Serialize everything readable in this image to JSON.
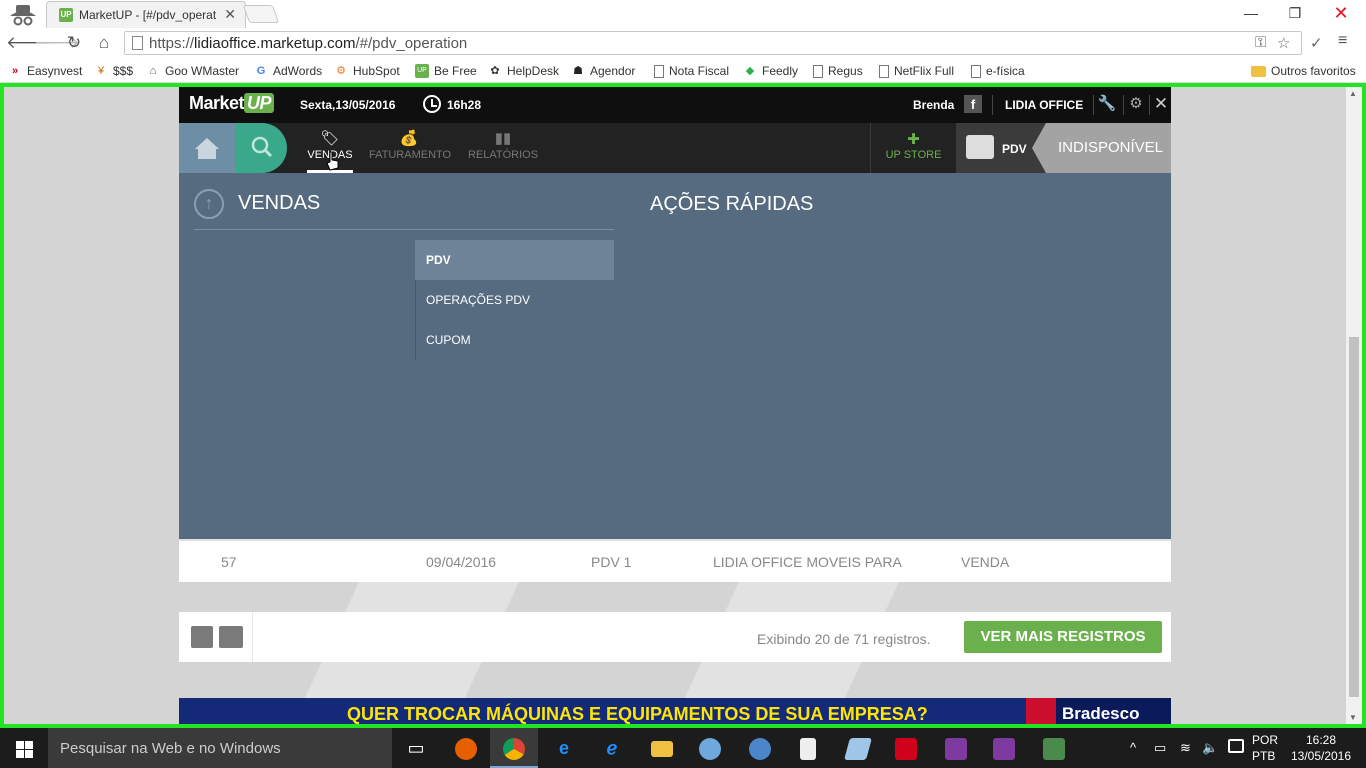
{
  "browser": {
    "tab_title": "MarketUP - [#/pdv_operat",
    "tab_favicon_text": "UP",
    "url_scheme": "https://",
    "url_host": "lidiaoffice.marketup.com",
    "url_path": "/#/pdv_operation",
    "window_minimize": "—",
    "window_restore": "❐",
    "window_close": "✕",
    "bookmarks": [
      {
        "label": "Easynvest",
        "icon": "easynvest-icon"
      },
      {
        "label": "$$$",
        "icon": "dollar-icon"
      },
      {
        "label": "Goo WMaster",
        "icon": "webmaster-icon"
      },
      {
        "label": "AdWords",
        "icon": "google-icon"
      },
      {
        "label": "HubSpot",
        "icon": "hubspot-icon"
      },
      {
        "label": "Be Free",
        "icon": "up-icon"
      },
      {
        "label": "HelpDesk",
        "icon": "helpdesk-icon"
      },
      {
        "label": "Agendor",
        "icon": "agendor-icon"
      },
      {
        "label": "Nota Fiscal",
        "icon": "page-icon"
      },
      {
        "label": "Feedly",
        "icon": "feedly-icon"
      },
      {
        "label": "Regus",
        "icon": "page-icon"
      },
      {
        "label": "NetFlix Full",
        "icon": "page-icon"
      },
      {
        "label": "e-física",
        "icon": "page-icon"
      }
    ],
    "other_bookmarks": "Outros favoritos"
  },
  "app": {
    "logo_text": "Market",
    "logo_badge": "UP",
    "date": "Sexta,13/05/2016",
    "time": "16h28",
    "user": "Brenda",
    "facebook_glyph": "f",
    "company": "LIDIA OFFICE",
    "nav": {
      "vendas": "VENDAS",
      "faturamento": "FATURAMENTO",
      "relatorios": "RELATÓRIOS",
      "upstore": "UP STORE",
      "pdv": "PDV",
      "pdv_status": "INDISPONÍVEL"
    },
    "dropdown": {
      "section_title": "VENDAS",
      "quick_actions_title": "AÇÕES RÁPIDAS",
      "menu": [
        "PDV",
        "OPERAÇÕES PDV",
        "CUPOM"
      ],
      "selected": "PDV"
    },
    "table_row": {
      "id": "57",
      "date": "09/04/2016",
      "pdv": "PDV 1",
      "client": "LIDIA OFFICE MOVEIS PARA",
      "type": "VENDA"
    },
    "footer": {
      "records_text": "Exibindo 20 de 71 registros.",
      "more_button": "VER MAIS REGISTROS"
    },
    "banner": {
      "text": "QUER TROCAR MÁQUINAS E EQUIPAMENTOS DE SUA EMPRESA?",
      "brand": "Bradesco"
    },
    "colors": {
      "accent_green": "#6ab04c",
      "dropdown_bg": "#566b80",
      "search_teal": "#3aa88a",
      "highlight_border": "#22e422"
    }
  },
  "taskbar": {
    "search_placeholder": "Pesquisar na Web e no Windows",
    "apps": [
      "task-view-icon",
      "firefox-icon",
      "chrome-icon",
      "edge-icon",
      "ie-icon",
      "file-explorer-icon",
      "network-icon",
      "mail-icon",
      "calculator-icon",
      "notes-icon",
      "acrobat-icon",
      "onenote-icon",
      "onenote-2016-icon",
      "app-icon"
    ],
    "language": "POR",
    "keyboard": "PTB",
    "time": "16:28",
    "date": "13/05/2016"
  }
}
